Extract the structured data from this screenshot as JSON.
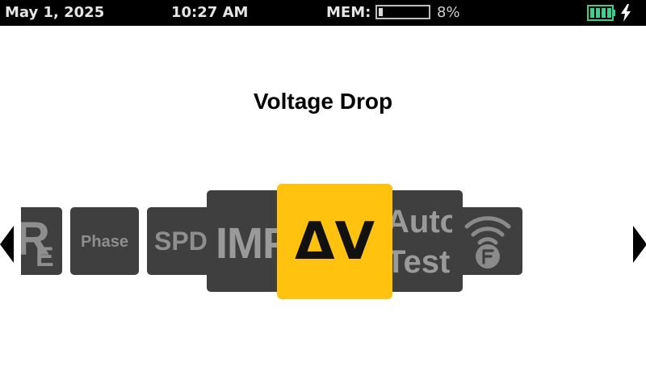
{
  "status_bar": {
    "date": "May 1, 2025",
    "time": "10:27 AM",
    "mem_label": "MEM:",
    "mem_percent": "8%",
    "mem_fraction": 0.08,
    "battery_level": 1.0,
    "battery_color": "#3ecf8e",
    "charging_icon": "lightning-bolt"
  },
  "title": "Voltage Drop",
  "carousel": {
    "active_color": "#ffc20e",
    "tile_color": "#3f3f3f",
    "tiles": [
      {
        "id": "re",
        "label_main": "R",
        "label_sub": "E"
      },
      {
        "id": "phase",
        "label": "Phase"
      },
      {
        "id": "spd",
        "label": "SPD"
      },
      {
        "id": "imp",
        "label": "IMP"
      },
      {
        "id": "voltage-drop",
        "label": "ΔV"
      },
      {
        "id": "auto-test",
        "label_line1": "Auto",
        "label_line2": "Test"
      },
      {
        "id": "wifi-fluke",
        "icon": "wifi-connect-icon"
      }
    ],
    "nav_left_icon": "triangle-left",
    "nav_right_icon": "triangle-right"
  }
}
